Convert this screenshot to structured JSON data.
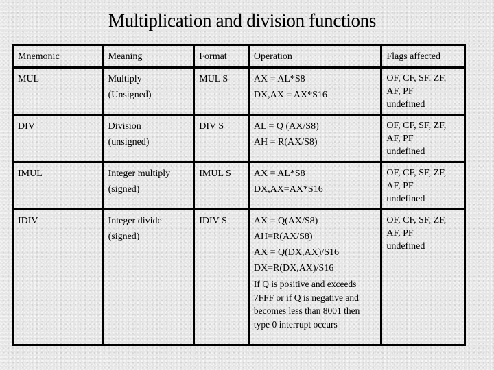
{
  "title": "Multiplication and division functions",
  "table": {
    "headers": {
      "mnemonic": "Mnemonic",
      "meaning": "Meaning",
      "format": "Format",
      "operation": "Operation",
      "flags": "Flags affected"
    },
    "rows": [
      {
        "mnemonic": "MUL",
        "meaning": [
          "Multiply",
          "(Unsigned)"
        ],
        "format": "MUL S",
        "operation": [
          "AX = AL*S8",
          "DX,AX = AX*S16"
        ],
        "note": "",
        "flags": [
          "OF, CF, SF, ZF,",
          "AF, PF",
          "undefined"
        ]
      },
      {
        "mnemonic": "DIV",
        "meaning": [
          "Division",
          "(unsigned)"
        ],
        "format": "DIV S",
        "operation": [
          "AL = Q (AX/S8)",
          "AH = R(AX/S8)"
        ],
        "note": "",
        "flags": [
          "OF, CF, SF, ZF,",
          "AF, PF",
          "undefined"
        ]
      },
      {
        "mnemonic": "IMUL",
        "meaning": [
          "Integer multiply",
          "(signed)"
        ],
        "format": "IMUL S",
        "operation": [
          "AX = AL*S8",
          "DX,AX=AX*S16"
        ],
        "note": "",
        "flags": [
          "OF, CF, SF, ZF,",
          "AF, PF",
          "undefined"
        ]
      },
      {
        "mnemonic": "IDIV",
        "meaning": [
          "Integer divide",
          "(signed)"
        ],
        "format": "IDIV S",
        "operation": [
          "AX = Q(AX/S8)",
          "AH=R(AX/S8)",
          "AX = Q(DX,AX)/S16",
          "DX=R(DX,AX)/S16"
        ],
        "note": "If Q is positive and exceeds 7FFF or if Q is negative and becomes less than 8001 then type 0 interrupt occurs",
        "flags": [
          "OF, CF, SF, ZF,",
          "AF, PF",
          "undefined"
        ]
      }
    ]
  }
}
